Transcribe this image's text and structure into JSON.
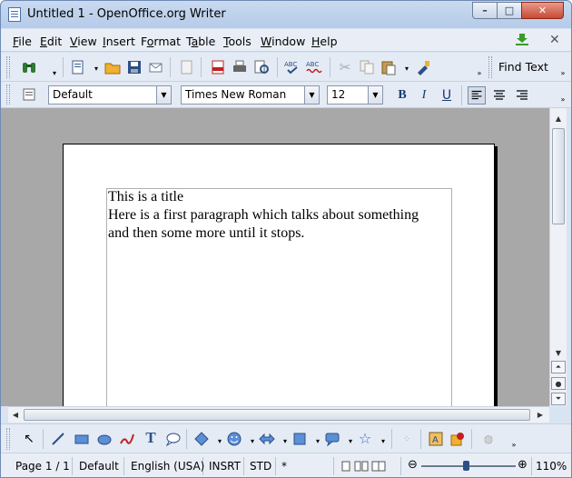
{
  "window": {
    "title": "Untitled 1 - OpenOffice.org Writer",
    "min": "–",
    "max": "□",
    "close": "✕"
  },
  "menus": [
    {
      "key": "F",
      "rest": "ile"
    },
    {
      "key": "E",
      "rest": "dit"
    },
    {
      "key": "V",
      "rest": "iew"
    },
    {
      "key": "I",
      "rest": "nsert"
    },
    {
      "pre": "F",
      "key": "o",
      "rest": "rmat"
    },
    {
      "pre": "T",
      "key": "a",
      "rest": "ble"
    },
    {
      "key": "T",
      "rest": "ools"
    },
    {
      "key": "W",
      "rest": "indow"
    },
    {
      "key": "H",
      "rest": "elp"
    }
  ],
  "menubar": {
    "close_glyph": "✕"
  },
  "toolbar": {
    "find_text": "Find Text"
  },
  "formatting": {
    "style": "Default",
    "font": "Times New Roman",
    "size": "12",
    "bold": "B",
    "italic": "I",
    "underline": "U"
  },
  "document": {
    "lines": [
      "This is a title",
      "Here is a first paragraph which talks about something",
      "and then some more until it stops."
    ]
  },
  "statusbar": {
    "page": "Page 1 / 1",
    "style": "Default",
    "language": "English (USA)",
    "insert_mode": "INSRT",
    "selection_mode": "STD",
    "modified": "*",
    "zoom": "110%"
  },
  "colors": {
    "accent": "#1a3a6e",
    "doc_bg": "#a8a8a8"
  }
}
